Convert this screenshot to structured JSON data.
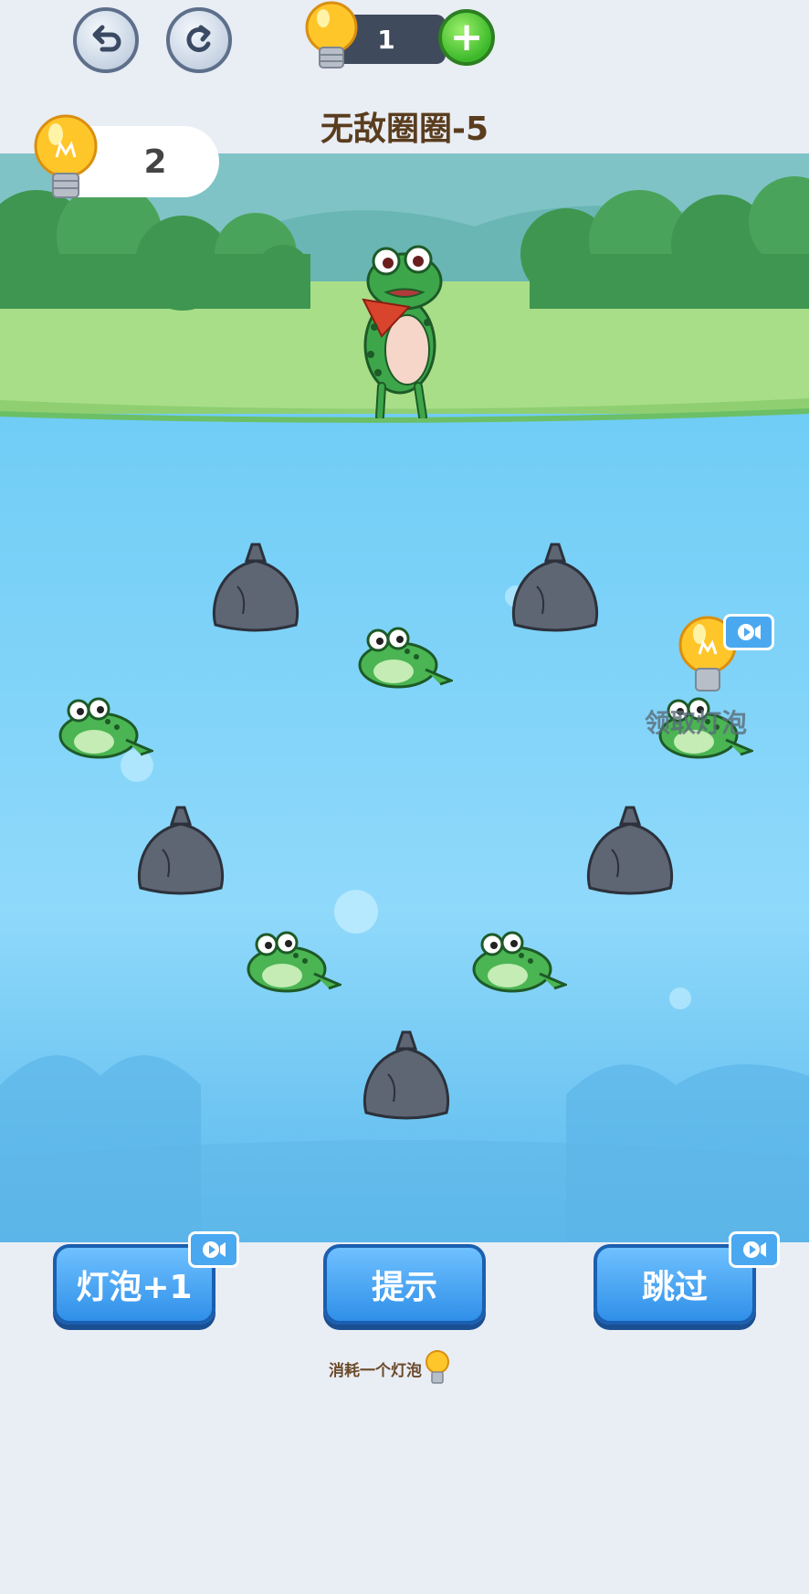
{
  "header": {
    "bulb_count_top": "1",
    "level_title": "无敌圈圈-5",
    "bulb_count_left": "2"
  },
  "scene": {
    "reward_label": "领取灯泡"
  },
  "buttons": {
    "add_bulb_label": "灯泡+1",
    "hint_label": "提示",
    "skip_label": "跳过"
  },
  "hint_cost_note": "消耗一个灯泡",
  "colors": {
    "water": "#6cc9f6",
    "grass": "#a7dd86",
    "bush": "#4a9d55",
    "button_blue": "#2f8fe8"
  }
}
